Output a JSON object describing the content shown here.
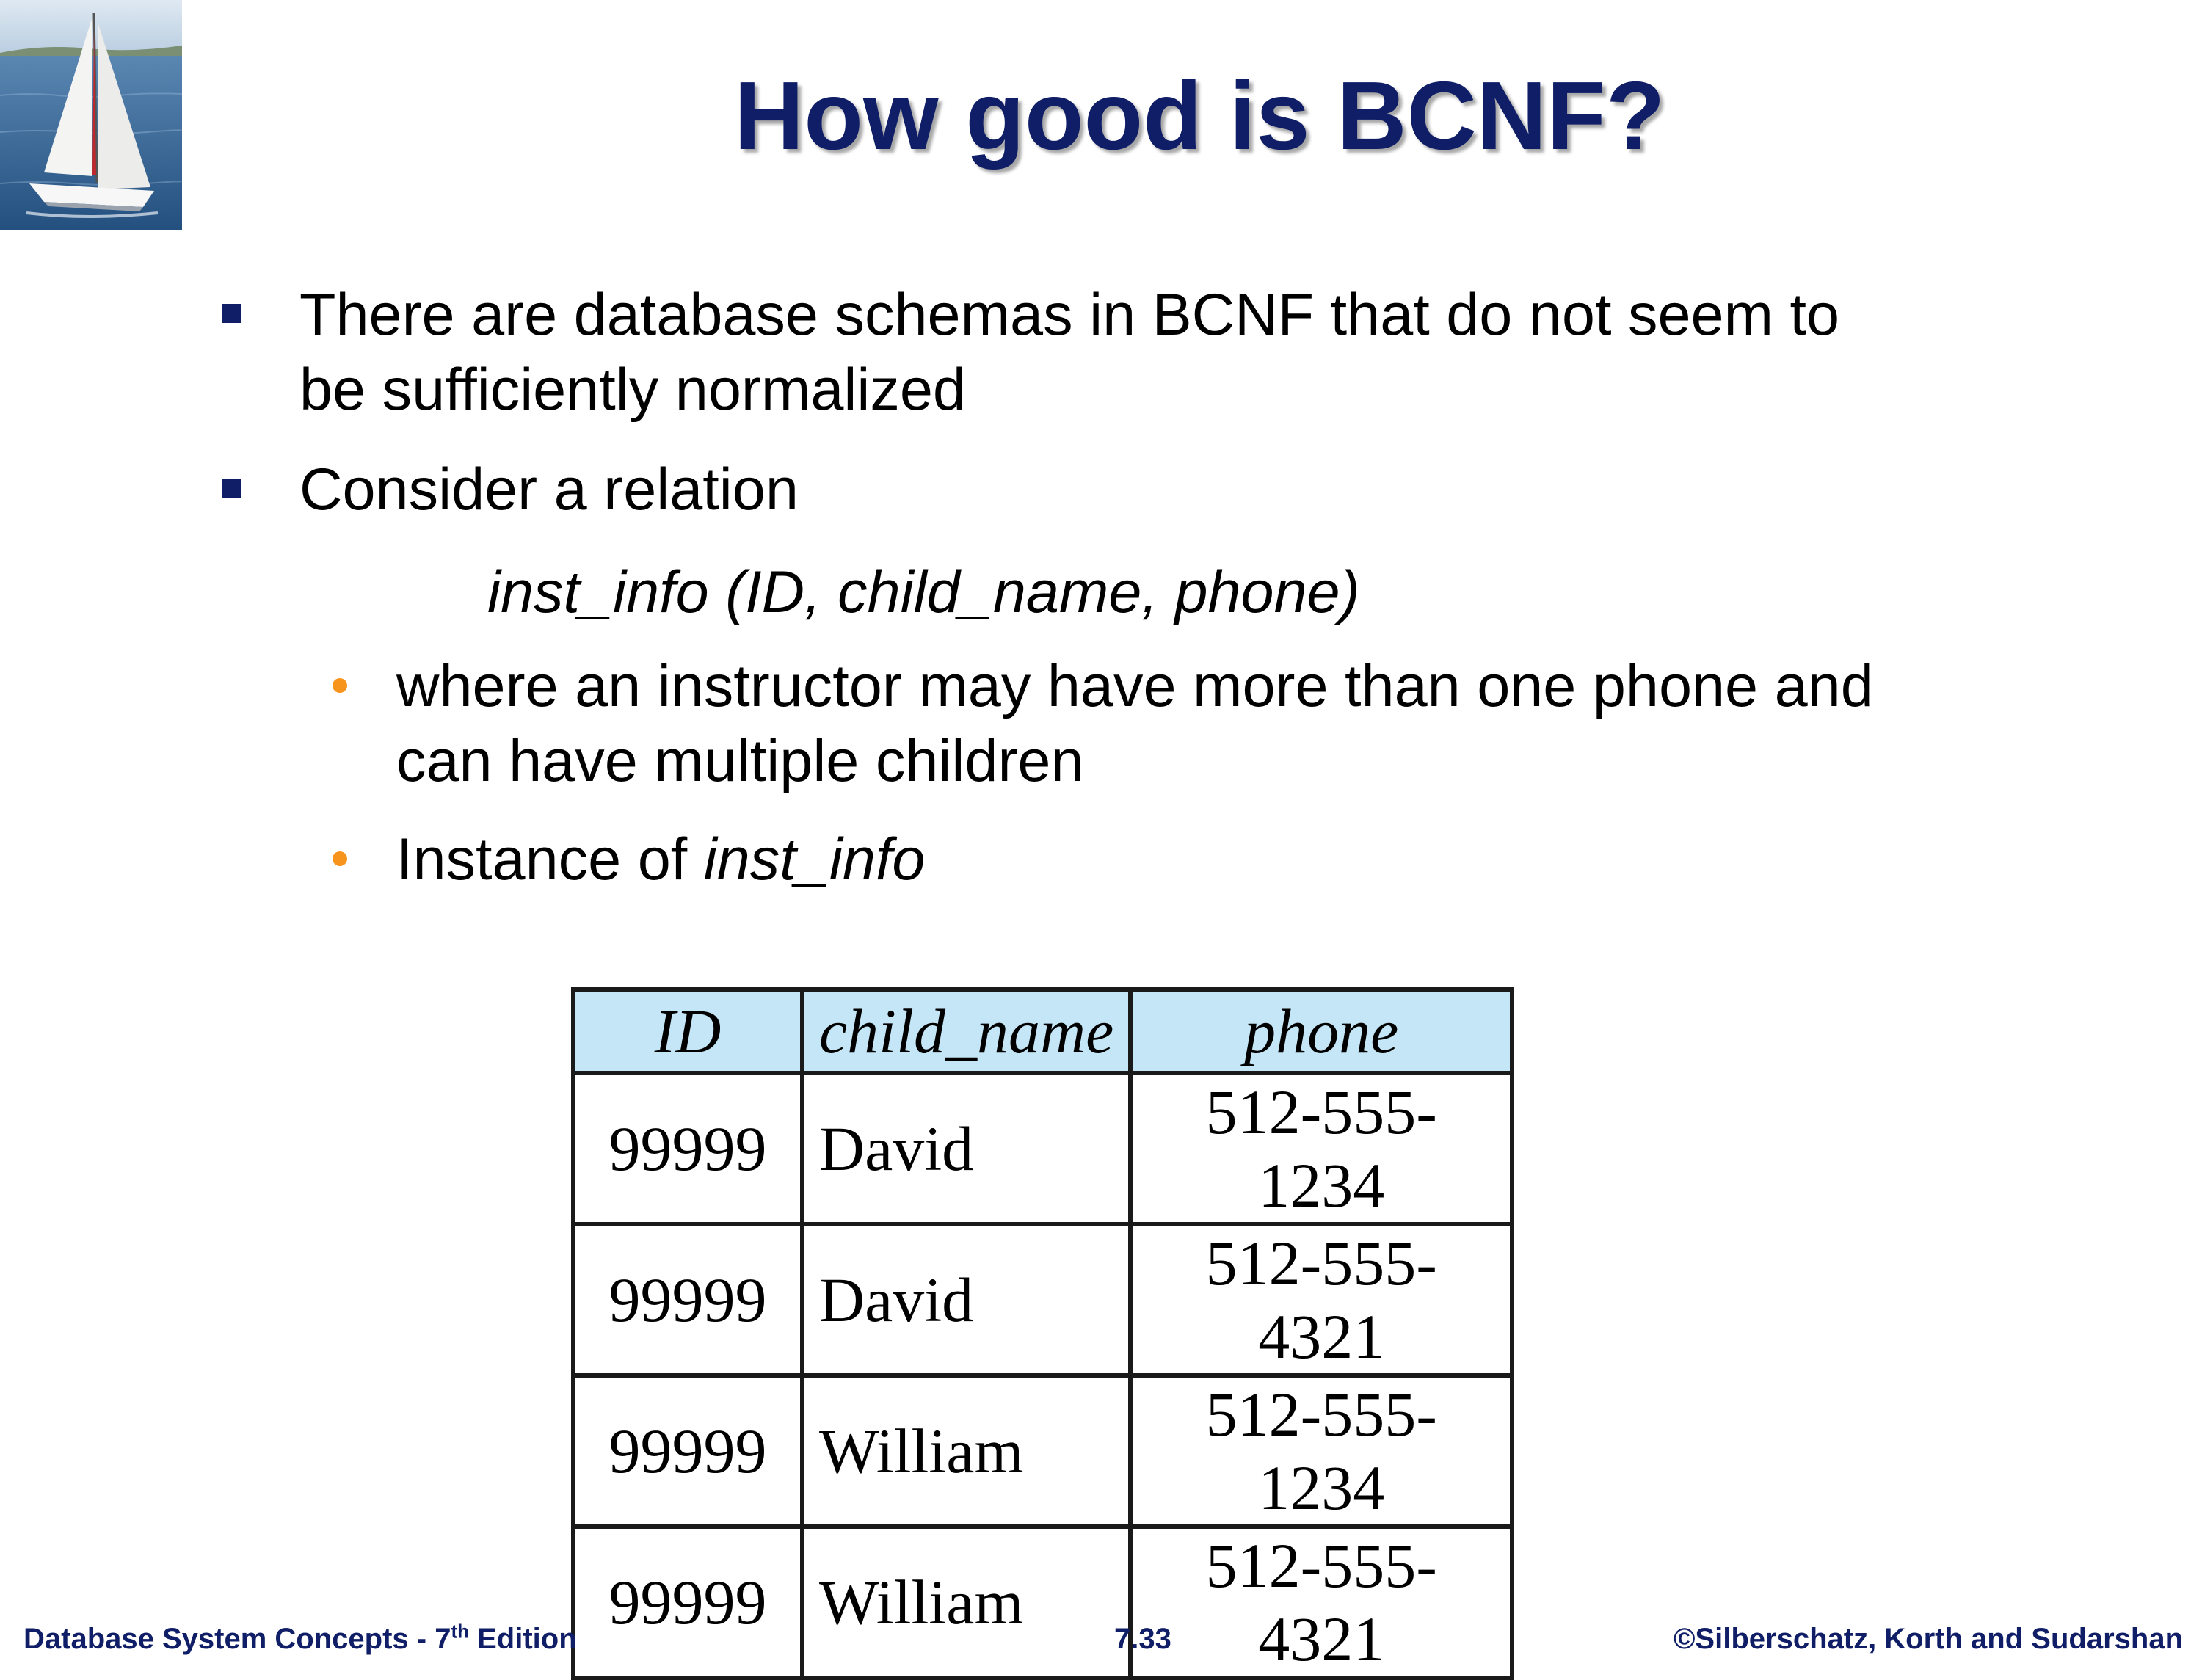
{
  "slide": {
    "title": "How good is BCNF?",
    "bullets": [
      {
        "line1": "There are database schemas in BCNF that do not seem to",
        "line2": "be sufficiently normalized"
      },
      {
        "text": "Consider a relation"
      }
    ],
    "relation": "inst_info (ID, child_name, phone)",
    "sub_bullets": [
      {
        "line1": "where an instructor may have more than one phone and",
        "line2": "can have multiple children"
      },
      {
        "prefix": "Instance of ",
        "italic": "inst_info"
      }
    ],
    "table": {
      "headers": [
        "ID",
        "child_name",
        "phone"
      ],
      "rows": [
        [
          "99999",
          "David",
          "512-555-1234"
        ],
        [
          "99999",
          "David",
          "512-555-4321"
        ],
        [
          "99999",
          "William",
          "512-555-1234"
        ],
        [
          "99999",
          "William",
          "512-555-4321"
        ]
      ]
    },
    "footer": {
      "left_main": "Database System Concepts - 7",
      "left_sup": "th",
      "left_tail": " Edition",
      "center": "7.33",
      "right": "©Silberschatz, Korth and Sudarshan"
    }
  },
  "colors": {
    "title": "#0f1e66",
    "bullet_square": "#0f1e66",
    "sub_bullet_dot": "#f7941d",
    "table_header_bg": "#c4e6f6"
  }
}
